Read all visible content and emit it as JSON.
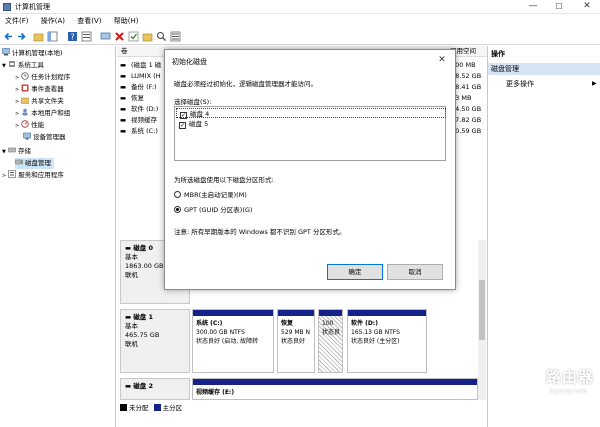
{
  "window": {
    "title": "计算机管理",
    "minimize": "—",
    "maximize": "☐",
    "close": "✕"
  },
  "menu": [
    "文件(F)",
    "操作(A)",
    "查看(V)",
    "帮助(H)"
  ],
  "tree": {
    "root": "计算机管理(本地)",
    "system_tools": "系统工具",
    "task_scheduler": "任务计划程序",
    "event_viewer": "事件查看器",
    "shared_folders": "共享文件夹",
    "local_users": "本地用户和组",
    "performance": "性能",
    "device_manager": "设备管理器",
    "storage": "存储",
    "disk_management": "磁盘管理",
    "services": "服务和应用程序"
  },
  "volume_list": {
    "header_left": "卷",
    "header_right": "可用空间",
    "rows": [
      {
        "name": "(磁盘 1 磁",
        "free": "100 MB"
      },
      {
        "name": "LUMIX (H",
        "free": "18.52 GB"
      },
      {
        "name": "备份 (F:)",
        "free": "48.41 GB"
      },
      {
        "name": "恢复",
        "free": "33 MB"
      },
      {
        "name": "软件 (D:)",
        "free": "34.50 GB"
      },
      {
        "name": "视频缓存",
        "free": "37.82 GB"
      },
      {
        "name": "系统 (C:)",
        "free": "50.59 GB"
      }
    ]
  },
  "actions": {
    "header": "操作",
    "selected": "磁盘管理",
    "more": "更多操作"
  },
  "disks": [
    {
      "name": "磁盘 0",
      "type": "基本",
      "size": "1863.00 GB",
      "status": "联机",
      "partitions": []
    },
    {
      "name": "磁盘 1",
      "type": "基本",
      "size": "465.75 GB",
      "status": "联机",
      "partitions": [
        {
          "name": "系统 (C:)",
          "size": "300.00 GB NTFS",
          "status": "状态良好 (启动, 故障转"
        },
        {
          "name": "恢复",
          "size": "529 MB N",
          "status": "状态良好"
        },
        {
          "name": "",
          "size": "100",
          "status": "状态良"
        },
        {
          "name": "软件 (D:)",
          "size": "165.13 GB NTFS",
          "status": "状态良好 (主分区)"
        }
      ]
    },
    {
      "name": "磁盘 2",
      "type": "",
      "size": "",
      "status": "",
      "partitions": [
        {
          "name": "视频缓存 (E:)",
          "size": "",
          "status": ""
        }
      ]
    }
  ],
  "legend": {
    "unallocated": "未分配",
    "primary": "主分区"
  },
  "dialog": {
    "title": "初始化磁盘",
    "close": "✕",
    "description": "磁盘必须经过初始化，逻辑磁盘管理器才能访问。",
    "select_label": "选择磁盘(S):",
    "disks": [
      {
        "label": "磁盘 4",
        "checked": "✓"
      },
      {
        "label": "磁盘 5",
        "checked": "✓"
      }
    ],
    "style_label": "为所选磁盘使用以下磁盘分区形式:",
    "mbr": "MBR(主启动记录)(M)",
    "gpt": "GPT (GUID 分区表)(G)",
    "note": "注意: 所有早期版本的 Windows 都不识别 GPT 分区形式。",
    "ok": "确定",
    "cancel": "取消"
  },
  "watermark": {
    "name": "路由器",
    "url": "luyouqi.com"
  },
  "colors": {
    "primary_partition": "#14228a",
    "unallocated": "#000000",
    "selection": "#cce4f7",
    "accent": "#0078d7"
  }
}
